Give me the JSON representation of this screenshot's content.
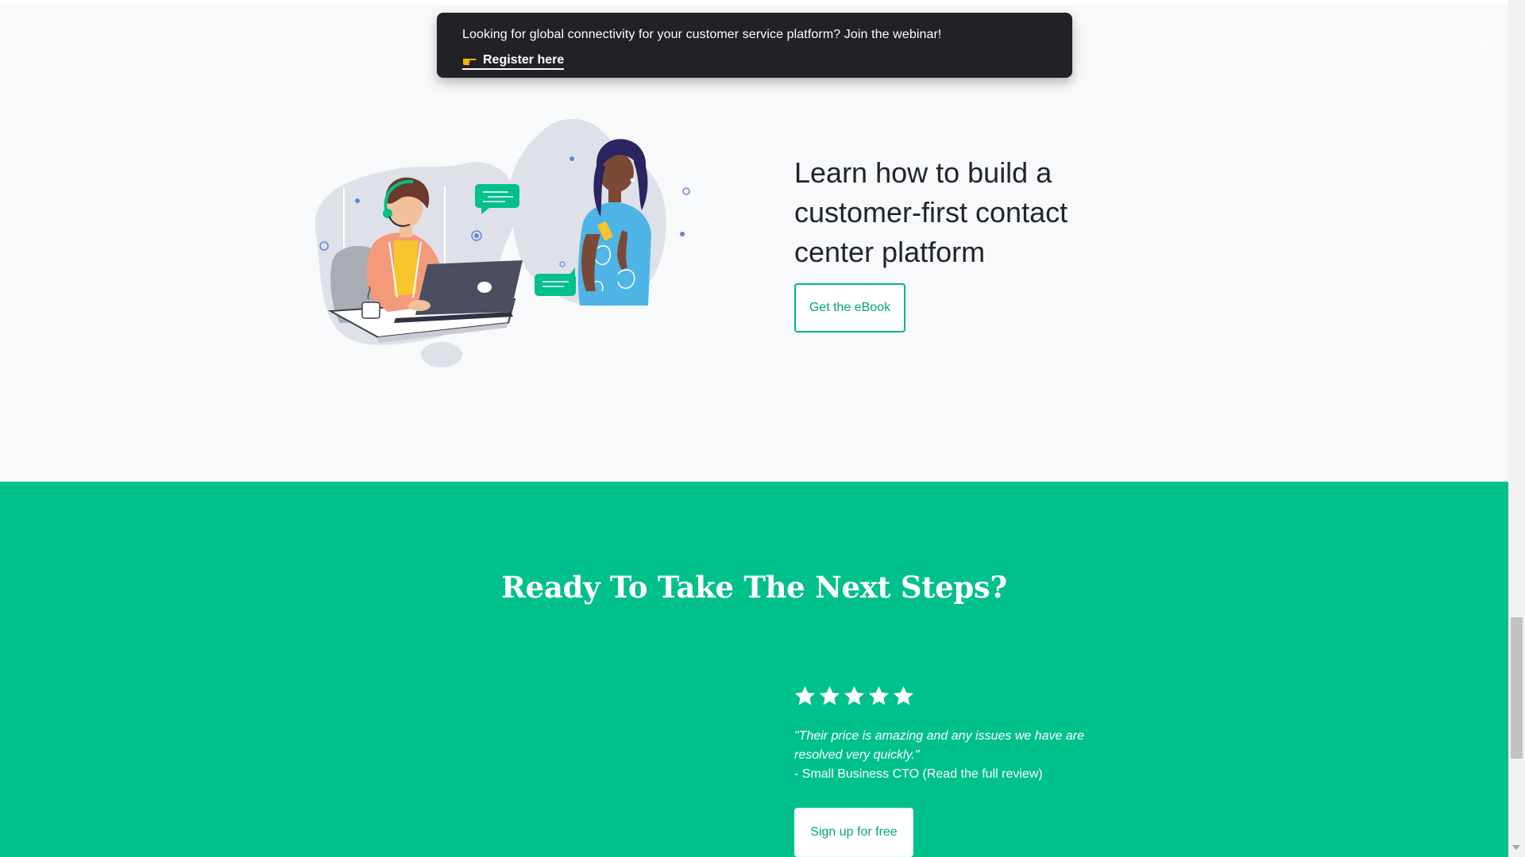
{
  "banner": {
    "text": "Looking for global connectivity for your customer service platform? Join the webinar!",
    "link_label": "Register here",
    "link_icon": "pointing-hand-icon",
    "close_icon": "close-icon"
  },
  "promo": {
    "heading": "Learn how to build a customer-first contact center platform",
    "button_label": "Get the eBook",
    "illustration": "contact-center-agent-and-customer-illustration"
  },
  "cta": {
    "heading": "Ready To Take The Next Steps?",
    "rating": 5,
    "rating_max": 5,
    "quote": "\"Their price is amazing and any issues we have are resolved very quickly.\"",
    "attribution": "- Small Business CTO (Read the full review)",
    "button_label": "Sign up for free"
  },
  "colors": {
    "page_bg": "#f8f9fa",
    "banner_bg": "#212226",
    "brand_green": "#00c08b",
    "button_text_green": "#00a678"
  }
}
